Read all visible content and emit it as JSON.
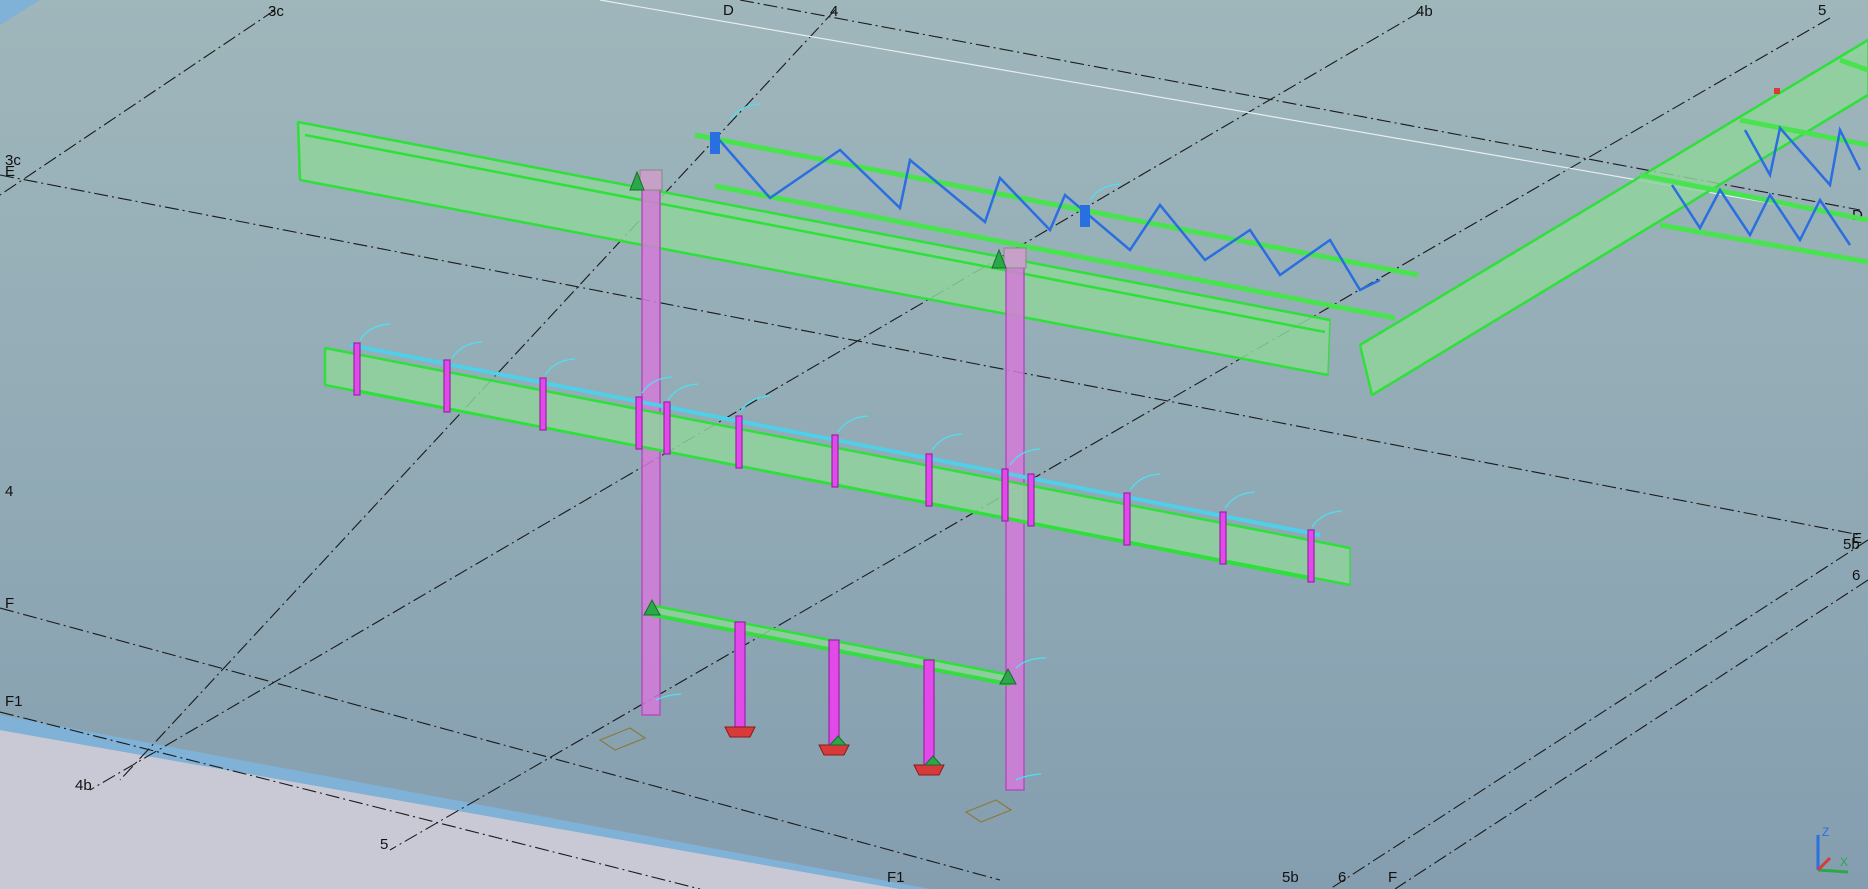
{
  "grid_labels": {
    "3c_top": "3c",
    "d_top": "D",
    "4_top": "4",
    "4b_top": "4b",
    "5_top": "5",
    "3c_left": "3c",
    "e_left": "E",
    "4_left": "4",
    "f_left": "F",
    "f1_left": "F1",
    "4b_bottom": "4b",
    "5_bottom": "5",
    "f1_bottom": "F1",
    "5b_bottom": "5b",
    "6_bottom": "6",
    "f_bottom": "F",
    "d_right": "D",
    "e_right": "E",
    "5b_right": "5b",
    "6_right": "6"
  },
  "axis_triad": {
    "z_label": "Z",
    "x_label": "X",
    "colors": {
      "x": "#2aa84a",
      "y": "#d83a3a",
      "z": "#2b6fe0"
    }
  },
  "colors": {
    "background": "#93acb6",
    "beam": "#8fd49c",
    "beam_edge": "#3fd84a",
    "column": "#d47ad8",
    "truss_web": "#2a6fe0",
    "tag": "#4fe0f0",
    "baseplate": "#d83a3a"
  }
}
